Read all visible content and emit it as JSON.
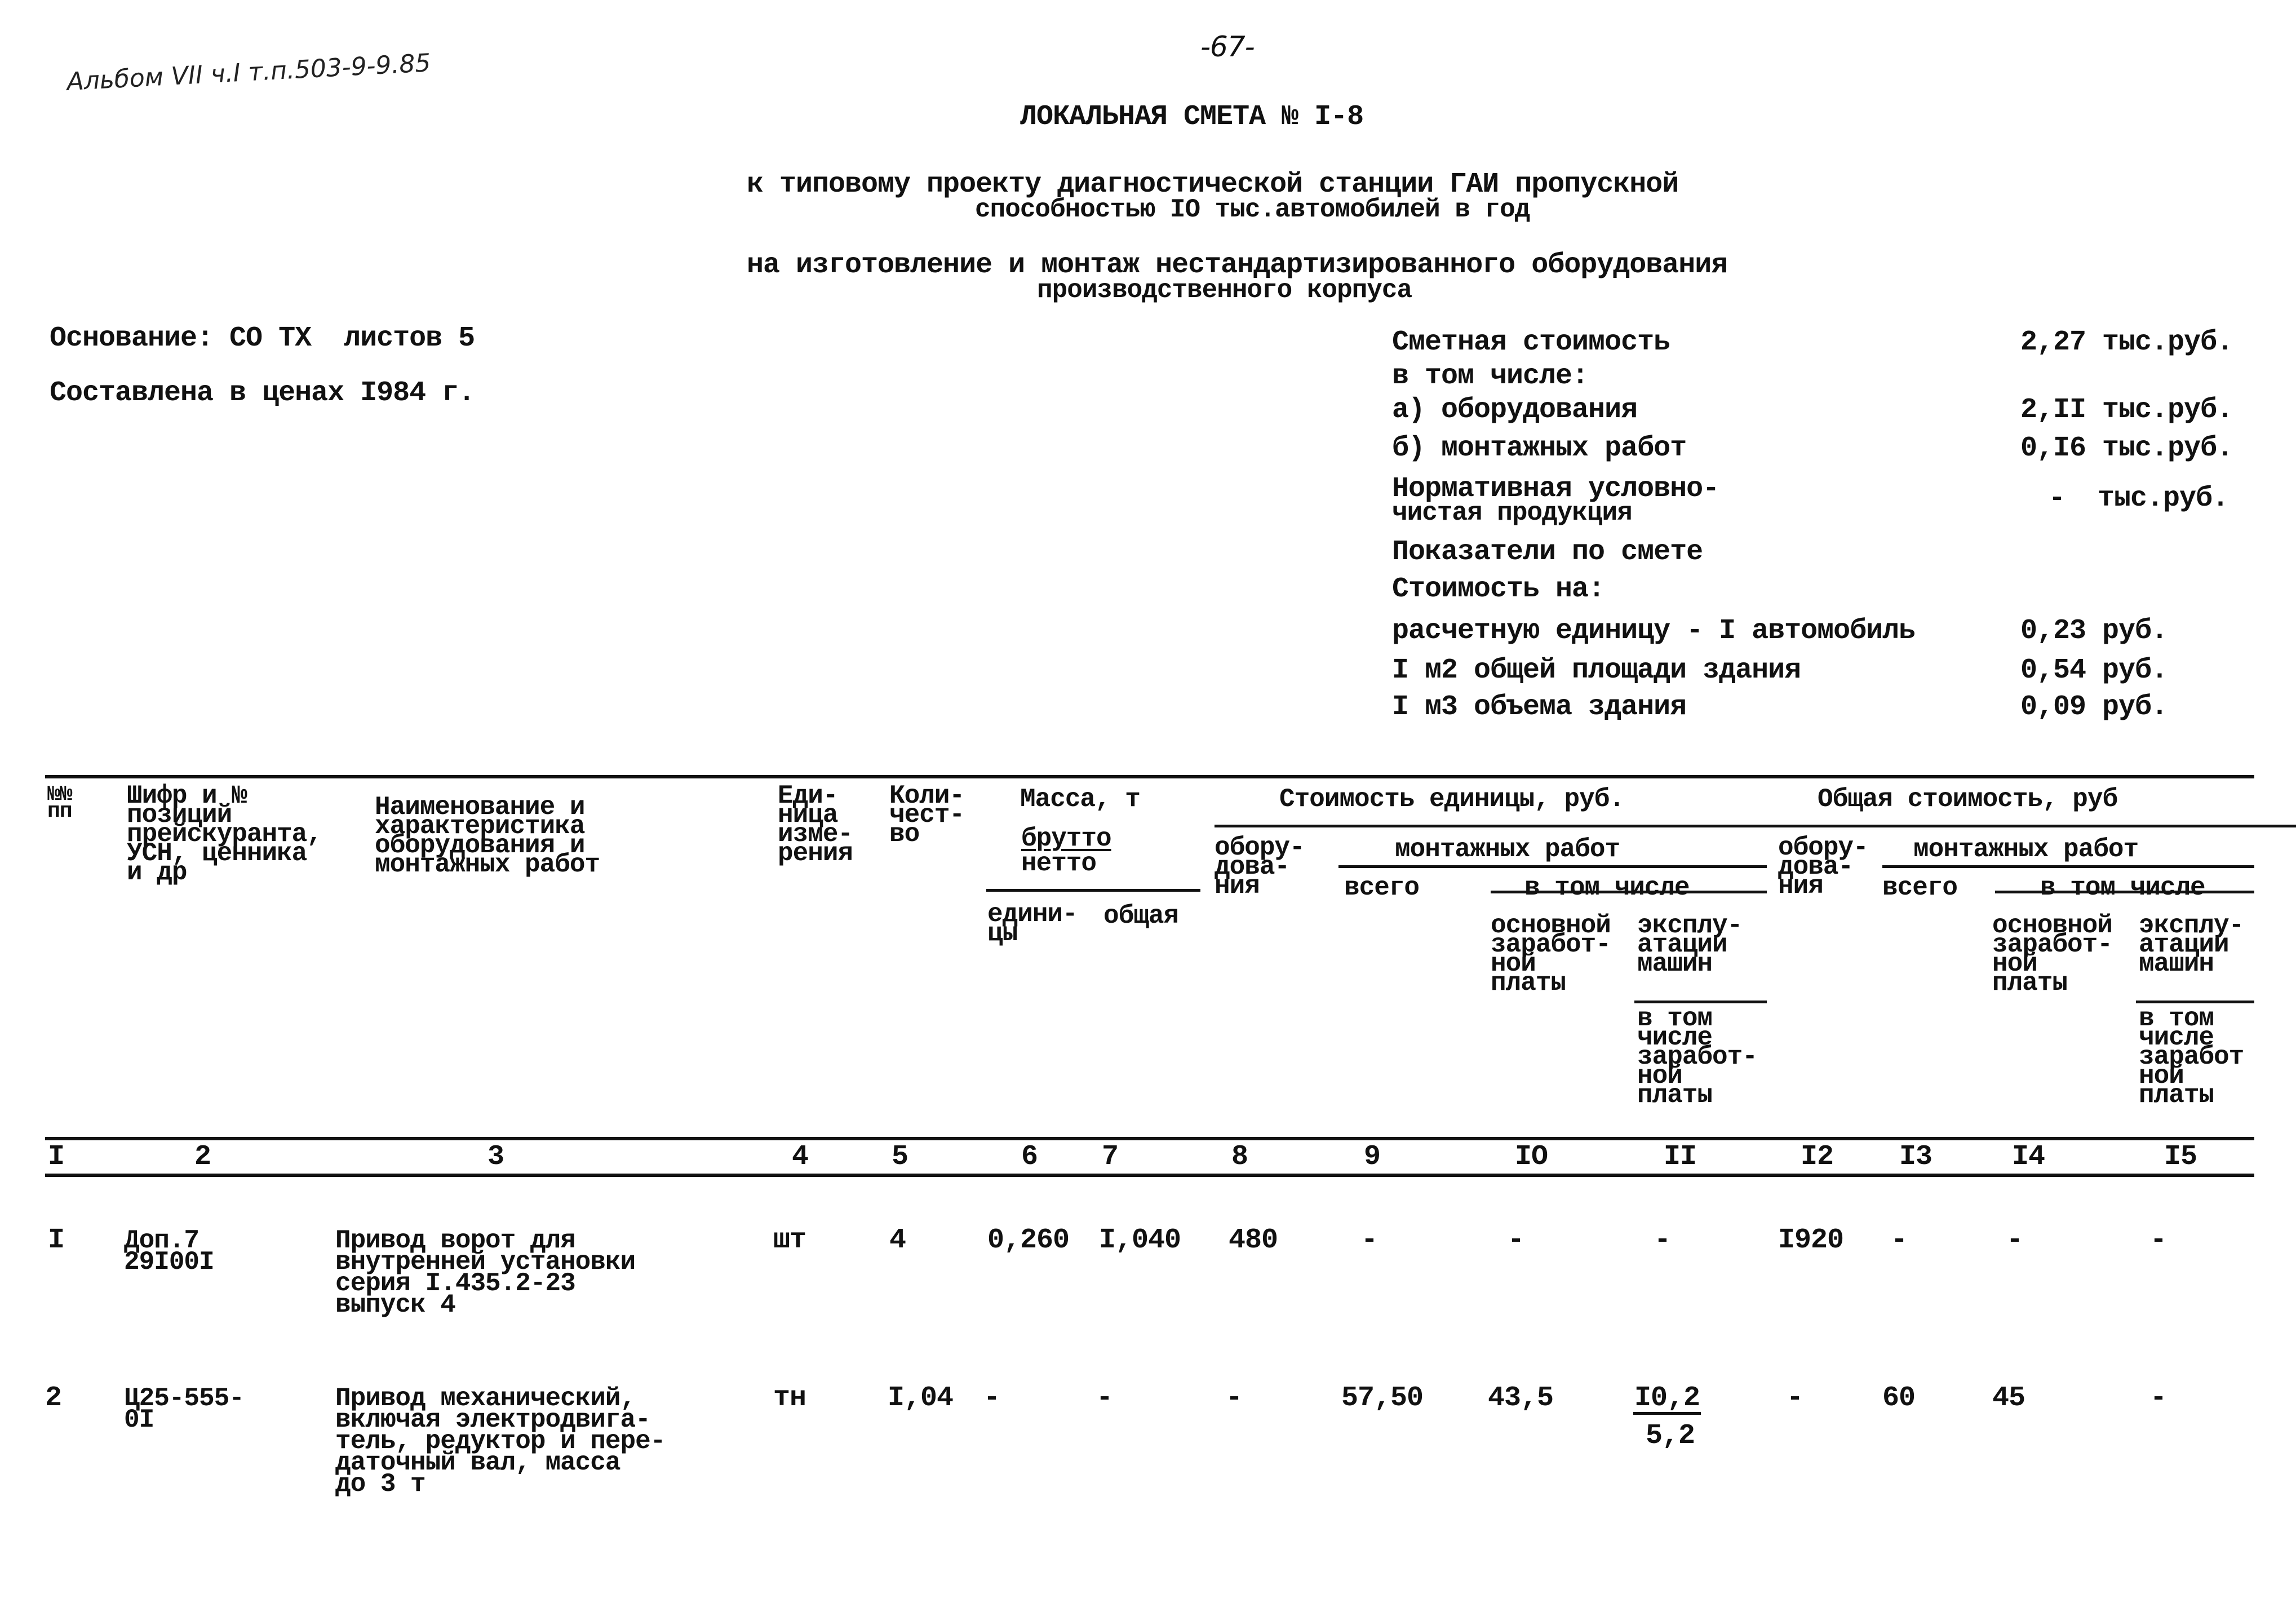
{
  "page": {
    "page_number": "-67-",
    "album_note": "Альбом VII ч.I т.п.503-9-9.85",
    "title": "ЛОКАЛЬНАЯ СМЕТА № I-8",
    "subtitle_1": [
      "к типовому проекту диагностической станции ГАИ пропускной",
      "способностью IO тыс.автомобилей в год"
    ],
    "subtitle_2": [
      "на изготовление и монтаж нестандартизированного оборудования",
      "производственного корпуса"
    ]
  },
  "basis": {
    "line_1": "Основание: СО ТХ  листов 5",
    "line_2": "Составлена в ценах I984 г."
  },
  "summary": {
    "estimated_cost_label": "Сметная стоимость",
    "estimated_cost_value": "2,27 тыс.руб.",
    "including_label": "в том числе:",
    "equipment_label": "а) оборудования",
    "equipment_value": "2,II тыс.руб.",
    "installation_label": "б) монтажных работ",
    "installation_value": "0,I6 тыс.руб.",
    "normative_label": [
      "Нормативная условно-",
      "чистая продукция"
    ],
    "normative_value": "-  тыс.руб.",
    "indicators_label": "Показатели по смете",
    "cost_for_label": "Стоимость на:",
    "per_unit_label": "расчетную единицу - I автомобиль",
    "per_unit_value": "0,23 руб.",
    "per_m2_label": "I м2 общей площади здания",
    "per_m2_value": "0,54 руб.",
    "per_m3_label": "I м3 объема здания",
    "per_m3_value": "0,09 руб."
  },
  "table": {
    "headers": {
      "col1": [
        "№№",
        "пп"
      ],
      "col2": [
        "Шифр и №",
        "позиций",
        "прейскуранта,",
        "УСН, ценника",
        "и др"
      ],
      "col3": [
        "Наименование и",
        "характеристика",
        "оборудования и",
        "монтажных работ"
      ],
      "col4": [
        "Еди-",
        "ница",
        "изме-",
        "рения"
      ],
      "col5": [
        "Коли-",
        "чест-",
        "во"
      ],
      "mass_group": "Масса, т",
      "mass_brutto": "брутто",
      "mass_netto": "нетто",
      "mass_unit": [
        "едини-",
        "цы"
      ],
      "mass_total": "общая",
      "unit_cost_group": "Стоимость единицы, руб.",
      "total_cost_group": "Общая стоимость, руб",
      "equipment": [
        "обору-",
        "дова-",
        "ния"
      ],
      "installation_group": "монтажных работ",
      "total": "всего",
      "including": "в том числе",
      "base_salary": [
        "основной",
        "заработ-",
        "ной",
        "платы"
      ],
      "machine_operation": [
        "эксплу-",
        "атации",
        "машин"
      ],
      "machine_salary_unit": [
        "в том",
        "числе",
        "заработ-",
        "ной",
        "платы"
      ],
      "machine_salary_total": [
        "в том",
        "числе",
        "заработ",
        "ной",
        "платы"
      ]
    },
    "column_numbers": [
      "I",
      "2",
      "3",
      "4",
      "5",
      "6",
      "7",
      "8",
      "9",
      "IO",
      "II",
      "I2",
      "I3",
      "I4",
      "I5"
    ],
    "rows": [
      {
        "num": "I",
        "code": [
          "Доп.7",
          "29I00I"
        ],
        "name": [
          "Привод ворот для",
          "внутренней установки",
          "серия I.435.2-23",
          "выпуск 4"
        ],
        "unit": "шт",
        "qty": "4",
        "mass_unit": "0,260",
        "mass_total": "I,040",
        "unit_equipment": "480",
        "unit_install_total": "-",
        "unit_base_salary": "-",
        "unit_machine": "-",
        "unit_machine_salary": "",
        "total_equipment": "I920",
        "total_install_total": "-",
        "total_base_salary": "-",
        "total_machine": "-"
      },
      {
        "num": "2",
        "code": [
          "Ц25-555-",
          "0I"
        ],
        "name": [
          "Привод механический,",
          "включая электродвига-",
          "тель, редуктор и пере-",
          "даточный вал, масса",
          "до 3 т"
        ],
        "unit": "тн",
        "qty": "I,04",
        "mass_unit": "-",
        "mass_total": "-",
        "unit_equipment": "-",
        "unit_install_total": "57,50",
        "unit_base_salary": "43,5",
        "unit_machine": "I0,2",
        "unit_machine_salary": "5,2",
        "total_equipment": "-",
        "total_install_total": "60",
        "total_base_salary": "45",
        "total_machine": "-"
      }
    ]
  }
}
